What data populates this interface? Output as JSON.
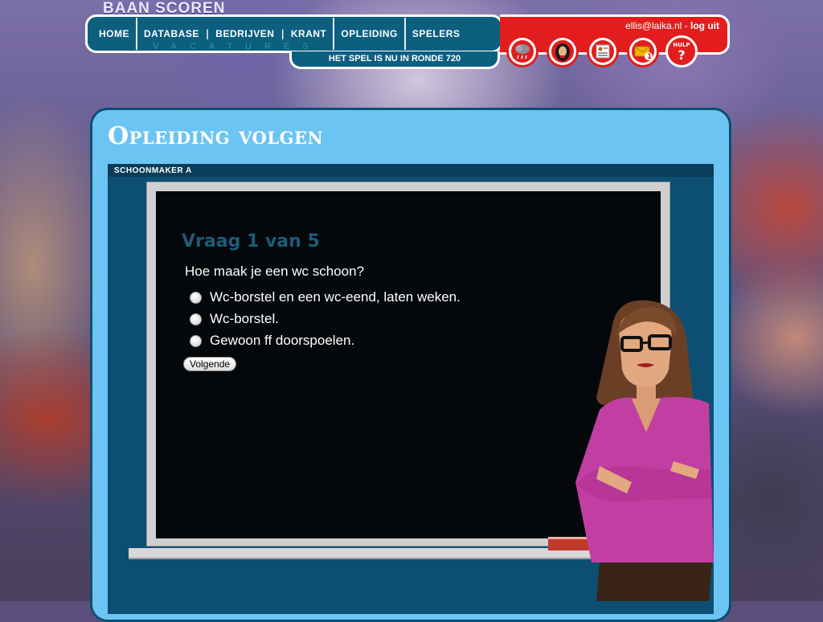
{
  "site": {
    "title": "BAAN SCOREN"
  },
  "nav": {
    "items": [
      "HOME",
      "DATABASE",
      "BEDRIJVEN",
      "KRANT",
      "OPLEIDING",
      "SPELERS"
    ],
    "sub_label": "VACATURES",
    "round_text": "HET SPEL IS NU IN RONDE 720"
  },
  "user": {
    "email": "ellis@laika.nl",
    "separator": "-",
    "logout": "log uit"
  },
  "icons": {
    "messages_count": "1",
    "help_label": "HULP",
    "help_mark": "?"
  },
  "page": {
    "title": "Opleiding volgen",
    "subtitle": "SCHOONMAKER A"
  },
  "quiz": {
    "heading": "Vraag 1 van 5",
    "question": "Hoe maak je een wc schoon?",
    "options": [
      "Wc-borstel en een wc-eend, laten weken.",
      "Wc-borstel.",
      "Gewoon ff doorspoelen."
    ],
    "next_label": "Volgende"
  },
  "colors": {
    "accent_red": "#e31d1d",
    "nav_blue": "#0d5f80",
    "panel_blue": "#6cc4f2",
    "board": "#05080b"
  }
}
